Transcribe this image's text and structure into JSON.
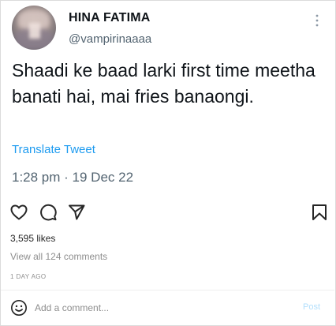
{
  "tweet": {
    "display_name": "HINA FATIMA",
    "handle": "@vampirinaaaa",
    "text": "Shaadi ke baad larki first time meetha banati hai, mai fries banaongi.",
    "translate_label": "Translate Tweet",
    "timestamp": "1:28 pm · 19 Dec 22",
    "more_icon": "more-vertical-icon"
  },
  "post": {
    "likes": "3,595 likes",
    "view_comments": "View all 124 comments",
    "time_ago": "1 DAY AGO",
    "icons": [
      "heart-icon",
      "comment-icon",
      "send-icon",
      "bookmark-icon"
    ]
  },
  "comment_box": {
    "placeholder": "Add a comment...",
    "post_label": "Post",
    "emoji_icon": "emoji-icon"
  },
  "colors": {
    "link": "#1d9bf0",
    "secondary_text": "#536471",
    "muted": "#8e8e8e",
    "post_disabled": "#b2dffc"
  }
}
